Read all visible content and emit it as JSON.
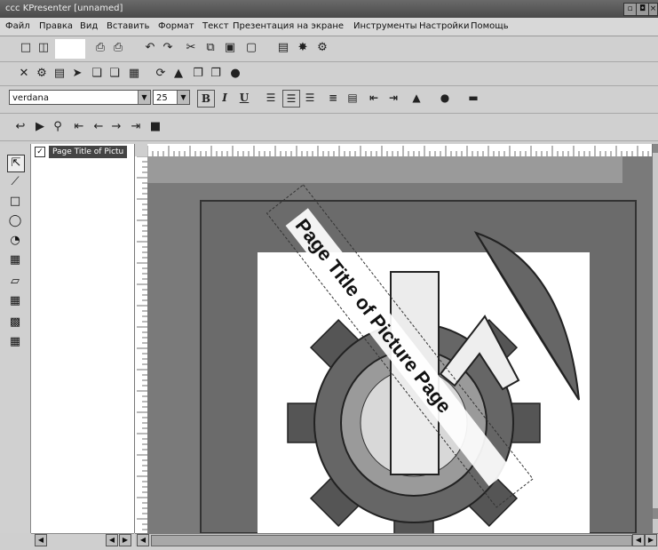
{
  "window": {
    "title": "KPresenter [unnamed]",
    "title_prefix": "ссс",
    "buttons": [
      "▫",
      "◘",
      "×"
    ]
  },
  "menu": [
    "Файл",
    "Правка",
    "Вид",
    "Вставить",
    "Формат",
    "Текст",
    "Презентация на экране",
    "Инструменты",
    "Настройки",
    "Помощь"
  ],
  "toolbar1": [
    "new-icon",
    "open-icon",
    "print-icon",
    "print-preview-icon",
    "undo-icon",
    "redo-icon",
    "cut-icon",
    "copy-icon",
    "paste-icon",
    "delete-icon",
    "page-list-icon",
    "star-icon",
    "zoom-icon"
  ],
  "toolbar2": [
    "text-tool-icon",
    "shape-tool-icon",
    "line-tool-icon",
    "arrow-tool-icon",
    "duplicate-icon",
    "group-icon",
    "align-icon",
    "rotate-icon",
    "shadow-icon",
    "raise-icon",
    "lower-icon",
    "effect-icon"
  ],
  "format": {
    "font": "verdana",
    "size": "25",
    "bold": "B",
    "italic": "I",
    "underline": "U"
  },
  "toolbar4": [
    "first-page-icon",
    "play-icon",
    "search-icon",
    "previous-page-icon",
    "back-icon",
    "forward-icon",
    "last-page-icon",
    "stop-icon"
  ],
  "left_tools": [
    "select-tool-icon",
    "line-icon",
    "rectangle-icon",
    "ellipse-icon",
    "pie-icon",
    "picture-icon",
    "polygon-icon",
    "table-icon",
    "chart-icon",
    "formula-icon"
  ],
  "outline": {
    "checked": "✓",
    "item": "Page Title of Pictu"
  },
  "slide": {
    "text": "Page Title of Picture Page"
  },
  "colors": {
    "title_bar": "#555555",
    "canvas": "#7a7a7a",
    "slide_bg": "#ffffff"
  }
}
